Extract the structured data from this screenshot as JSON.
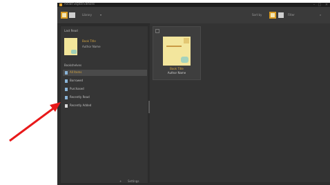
{
  "window": {
    "title": "Adobe Digital Editions",
    "minimize_icon": "minimize-icon",
    "maximize_icon": "maximize-icon",
    "close_icon": "close-icon"
  },
  "toolbar": {
    "library_view": "library-view-icon",
    "reading_view": "reading-view-icon",
    "library_label": "Library",
    "sort_label": "Sort by",
    "grid_view": "grid-view-icon",
    "list_view": "list-view-icon",
    "filter_label": "Filter"
  },
  "sidebar": {
    "last_read_header": "Last Read",
    "last_read_book": {
      "title": "Book Title",
      "author": "Author Name"
    },
    "bookshelves_header": "Bookshelves",
    "shelves": [
      {
        "label": "All Items",
        "selected": true
      },
      {
        "label": "Borrowed"
      },
      {
        "label": "Purchased"
      },
      {
        "label": "Recently Read"
      },
      {
        "label": "Recently Added"
      }
    ],
    "bottom_buttons": [
      "+",
      "Settings"
    ]
  },
  "library": {
    "books": [
      {
        "title": "Book Title",
        "author": "Author Name",
        "selected": false
      }
    ]
  },
  "colors": {
    "accent": "#d99b22",
    "background": "#2d2d2d",
    "arrow": "#e8191a"
  }
}
